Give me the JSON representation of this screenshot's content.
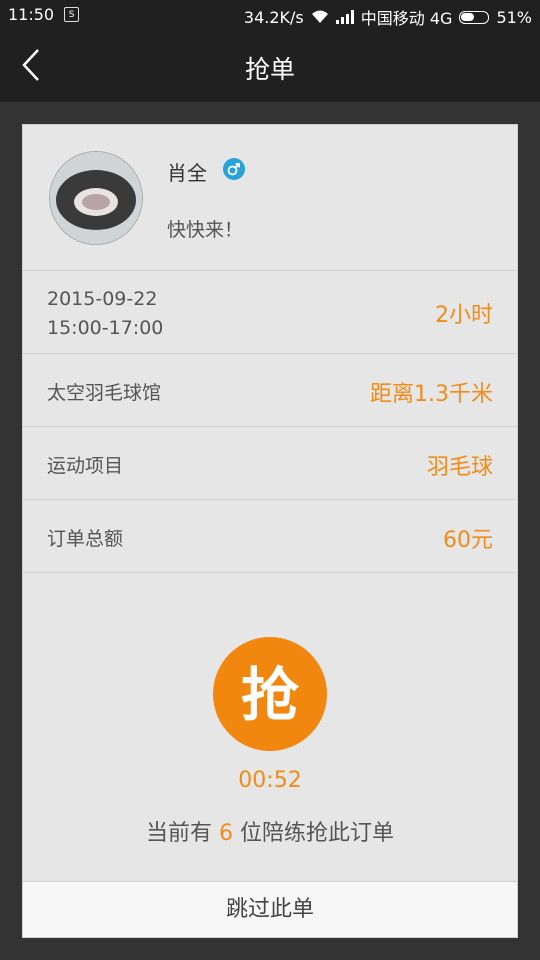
{
  "status_bar": {
    "time": "11:50",
    "sim_label": "S",
    "speed": "34.2K/s",
    "carrier": "中国移动 4G",
    "battery": "51%",
    "battery_level": 0.51
  },
  "header": {
    "title": "抢单"
  },
  "profile": {
    "name": "肖全",
    "gender_symbol": "♂",
    "bio": "快快来！"
  },
  "order": {
    "date": "2015-09-22",
    "time_range": "15:00-17:00",
    "duration": "2小时",
    "venue": "太空羽毛球馆",
    "distance": "距离1.3千米",
    "sport_label": "运动项目",
    "sport": "羽毛球",
    "total_label": "订单总额",
    "total": "60元"
  },
  "grab": {
    "button_char": "抢",
    "countdown": "00:52",
    "notice_prefix": "当前有 ",
    "count": "6",
    "notice_suffix": " 位陪练抢此订单"
  },
  "skip_label": "跳过此单",
  "colors": {
    "accent": "#f08c19",
    "header_bg": "#202020",
    "card_bg": "#e6e6e6",
    "gender_blue": "#27a3d9"
  }
}
